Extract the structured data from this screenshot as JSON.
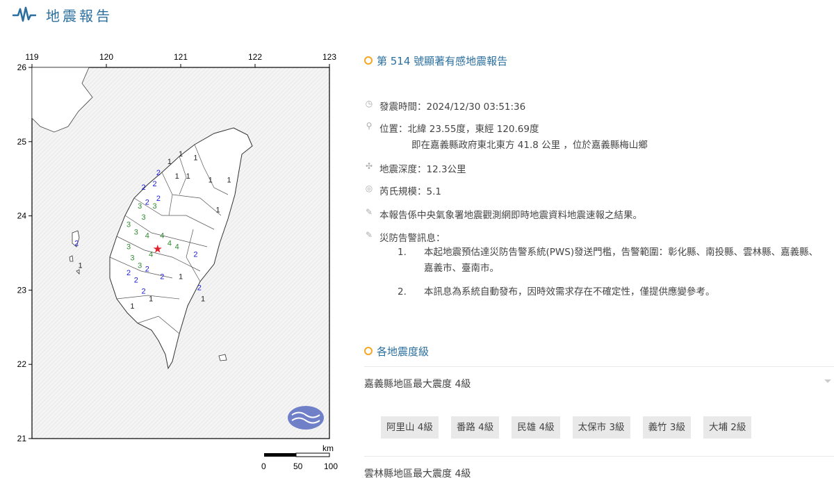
{
  "header": {
    "title": "地震報告"
  },
  "report": {
    "title": "第 514 號顯著有感地震報告",
    "time_label": "發震時間：2024/12/30 03:51:36",
    "location_label": "位置：北緯 23.55度，東經 120.69度",
    "location_detail": "即在嘉義縣政府東北東方 41.8 公里 ，位於嘉義縣梅山鄉",
    "depth_label": "地震深度：12.3公里",
    "magnitude_label": "芮氏規模：5.1",
    "source_note": "本報告係中央氣象署地震觀測網即時地震資料地震速報之結果。",
    "warning_label": "災防告警訊息：",
    "warnings": [
      {
        "num": "1.",
        "text": "本起地震預估達災防告警系統(PWS)發送門檻，告警範圍：彰化縣、南投縣、雲林縣、嘉義縣、嘉義市、臺南市。"
      },
      {
        "num": "2.",
        "text": "本訊息為系統自動發布，因時效需求存在不確定性，僅提供應變參考。"
      }
    ]
  },
  "intensity": {
    "title": "各地震度級",
    "regions": [
      {
        "label": "嘉義縣地區最大震度 4級",
        "stations": [
          "阿里山 4級",
          "番路 4級",
          "民雄 4級",
          "太保市 3級",
          "義竹 3級",
          "大埔 2級"
        ]
      },
      {
        "label": "雲林縣地區最大震度 4級"
      }
    ]
  },
  "map": {
    "lon_ticks": [
      "119",
      "120",
      "121",
      "122",
      "123"
    ],
    "lat_ticks": [
      "26",
      "25",
      "24",
      "23",
      "22",
      "21"
    ],
    "scale_unit": "km",
    "scale_labels": [
      "0",
      "50",
      "100"
    ],
    "epicenter": {
      "lon": 120.69,
      "lat": 23.55,
      "marker": "★"
    },
    "colors": {
      "i1": "#222222",
      "i2": "#1a1adb",
      "i3": "#2e8b2e",
      "i4": "#2e8b2e",
      "epicenter": "#e0202a",
      "accent": "#2b6f9e",
      "ring": "#f5a623"
    },
    "stations": [
      {
        "i": "1",
        "lon": 121.0,
        "lat": 24.8
      },
      {
        "i": "1",
        "lon": 121.2,
        "lat": 24.75
      },
      {
        "i": "1",
        "lon": 120.85,
        "lat": 24.7
      },
      {
        "i": "1",
        "lon": 120.95,
        "lat": 24.5
      },
      {
        "i": "1",
        "lon": 121.1,
        "lat": 24.5
      },
      {
        "i": "1",
        "lon": 121.4,
        "lat": 24.45
      },
      {
        "i": "1",
        "lon": 121.65,
        "lat": 24.45
      },
      {
        "i": "2",
        "lon": 120.7,
        "lat": 24.55
      },
      {
        "i": "2",
        "lon": 120.5,
        "lat": 24.35
      },
      {
        "i": "2",
        "lon": 120.65,
        "lat": 24.4
      },
      {
        "i": "2",
        "lon": 120.55,
        "lat": 24.15
      },
      {
        "i": "2",
        "lon": 120.7,
        "lat": 24.2
      },
      {
        "i": "3",
        "lon": 120.45,
        "lat": 24.1
      },
      {
        "i": "3",
        "lon": 120.65,
        "lat": 24.1
      },
      {
        "i": "3",
        "lon": 120.5,
        "lat": 23.95
      },
      {
        "i": "3",
        "lon": 120.3,
        "lat": 23.85
      },
      {
        "i": "3",
        "lon": 120.4,
        "lat": 23.75
      },
      {
        "i": "4",
        "lon": 120.55,
        "lat": 23.7
      },
      {
        "i": "4",
        "lon": 120.75,
        "lat": 23.7
      },
      {
        "i": "4",
        "lon": 120.85,
        "lat": 23.6
      },
      {
        "i": "4",
        "lon": 120.6,
        "lat": 23.45
      },
      {
        "i": "4",
        "lon": 120.95,
        "lat": 23.55
      },
      {
        "i": "3",
        "lon": 120.3,
        "lat": 23.55
      },
      {
        "i": "3",
        "lon": 120.35,
        "lat": 23.4
      },
      {
        "i": "3",
        "lon": 120.45,
        "lat": 23.3
      },
      {
        "i": "2",
        "lon": 120.3,
        "lat": 23.2
      },
      {
        "i": "2",
        "lon": 120.4,
        "lat": 23.1
      },
      {
        "i": "2",
        "lon": 120.55,
        "lat": 23.25
      },
      {
        "i": "2",
        "lon": 120.75,
        "lat": 23.15
      },
      {
        "i": "2",
        "lon": 120.5,
        "lat": 22.95
      },
      {
        "i": "2",
        "lon": 121.2,
        "lat": 23.45
      },
      {
        "i": "2",
        "lon": 121.25,
        "lat": 23.0
      },
      {
        "i": "1",
        "lon": 121.0,
        "lat": 23.15
      },
      {
        "i": "1",
        "lon": 121.3,
        "lat": 22.85
      },
      {
        "i": "1",
        "lon": 120.35,
        "lat": 22.75
      },
      {
        "i": "1",
        "lon": 120.6,
        "lat": 22.85
      },
      {
        "i": "1",
        "lon": 121.5,
        "lat": 24.05
      },
      {
        "i": "2",
        "lon": 119.6,
        "lat": 23.6
      },
      {
        "i": "1",
        "lon": 119.65,
        "lat": 23.3
      }
    ]
  }
}
